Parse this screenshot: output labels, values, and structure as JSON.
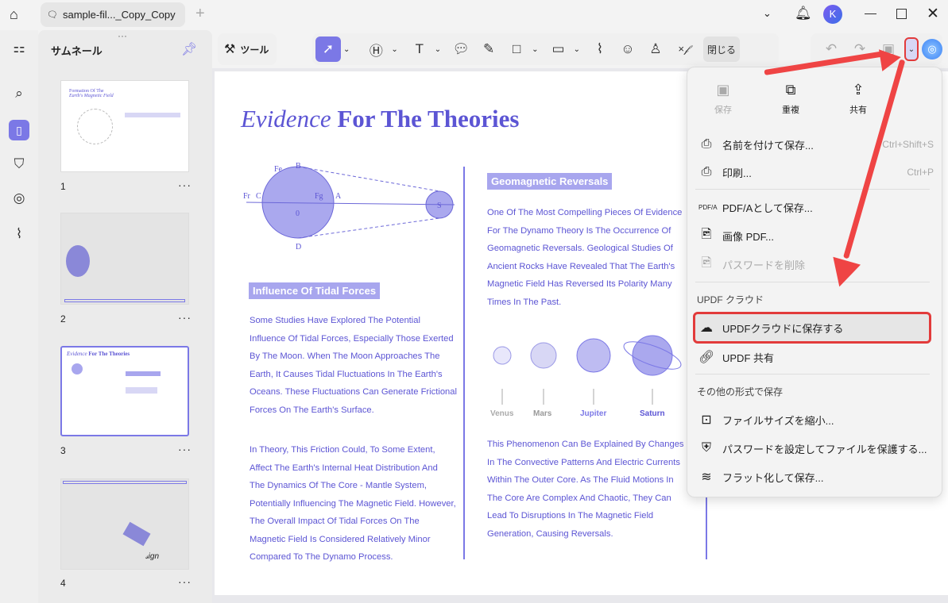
{
  "titlebar": {
    "tab_title": "sample-fil..._Copy_Copy",
    "avatar_letter": "K"
  },
  "sidebar": {
    "panel_title": "サムネール",
    "pages": [
      "1",
      "2",
      "3",
      "4"
    ],
    "more": "···"
  },
  "toolbar": {
    "tools_label": "ツール",
    "close_label": "閉じる"
  },
  "document": {
    "title_italic": "Evidence",
    "title_bold": "For The Theories",
    "diagram_labels": {
      "fr": "Fr",
      "c": "C",
      "fg": "Fg",
      "b": "B",
      "fe": "Fe",
      "zero": "0",
      "a": "A",
      "d": "D",
      "s": "S"
    },
    "tidal_heading": "Influence Of Tidal Forces",
    "tidal_para1": [
      "Some Studies Have Explored The Potential",
      "Influence Of Tidal Forces, Especially Those Exerted",
      "By The Moon. When The Moon Approaches The",
      "Earth, It Causes Tidal Fluctuations In The Earth's",
      "Oceans. These Fluctuations Can Generate Frictional",
      "Forces On The Earth's Surface."
    ],
    "tidal_para2": [
      "In Theory, This Friction Could, To Some Extent,",
      "Affect The Earth's Internal Heat Distribution And",
      "The Dynamics Of The Core - Mantle System,",
      "Potentially Influencing The Magnetic Field. However,",
      "The Overall Impact Of Tidal Forces On The",
      "Magnetic Field Is Considered Relatively Minor",
      "Compared To The Dynamo Process."
    ],
    "reversal_heading": "Geomagnetic Reversals",
    "reversal_para": [
      "One Of The Most Compelling Pieces Of Evidence",
      "For The Dynamo Theory Is The Occurrence Of",
      "Geomagnetic Reversals. Geological Studies Of",
      "Ancient Rocks Have Revealed That The Earth's",
      "Magnetic Field Has Reversed Its Polarity Many",
      "Times In The Past."
    ],
    "planets": [
      "Venus",
      "Mars",
      "Jupiter",
      "Saturn"
    ],
    "phenomenon_para": [
      "This Phenomenon Can Be Explained By Changes",
      "In The Convective Patterns And Electric Currents",
      "Within The Outer Core. As The Fluid Motions In",
      "The Core Are Complex And Chaotic, They Can",
      "Lead To Disruptions In The Magnetic Field",
      "Generation, Causing Reversals."
    ]
  },
  "menu": {
    "top": [
      {
        "label": "保存",
        "disabled": true
      },
      {
        "label": "重複"
      },
      {
        "label": "共有"
      }
    ],
    "save_as": "名前を付けて保存...",
    "save_as_shortcut": "Ctrl+Shift+S",
    "print": "印刷...",
    "print_shortcut": "Ctrl+P",
    "pdfa": "PDF/Aとして保存...",
    "image_pdf": "画像 PDF...",
    "remove_password": "パスワードを削除",
    "cloud_section": "UPDF クラウド",
    "save_cloud": "UPDFクラウドに保存する",
    "updf_share": "UPDF 共有",
    "other_section": "その他の形式で保存",
    "reduce": "ファイルサイズを縮小...",
    "protect": "パスワードを設定してファイルを保護する...",
    "flatten": "フラット化して保存..."
  },
  "colors": {
    "accent": "#7b78e6",
    "doc_text": "#5c55d4",
    "highlight": "#e23b3b"
  }
}
